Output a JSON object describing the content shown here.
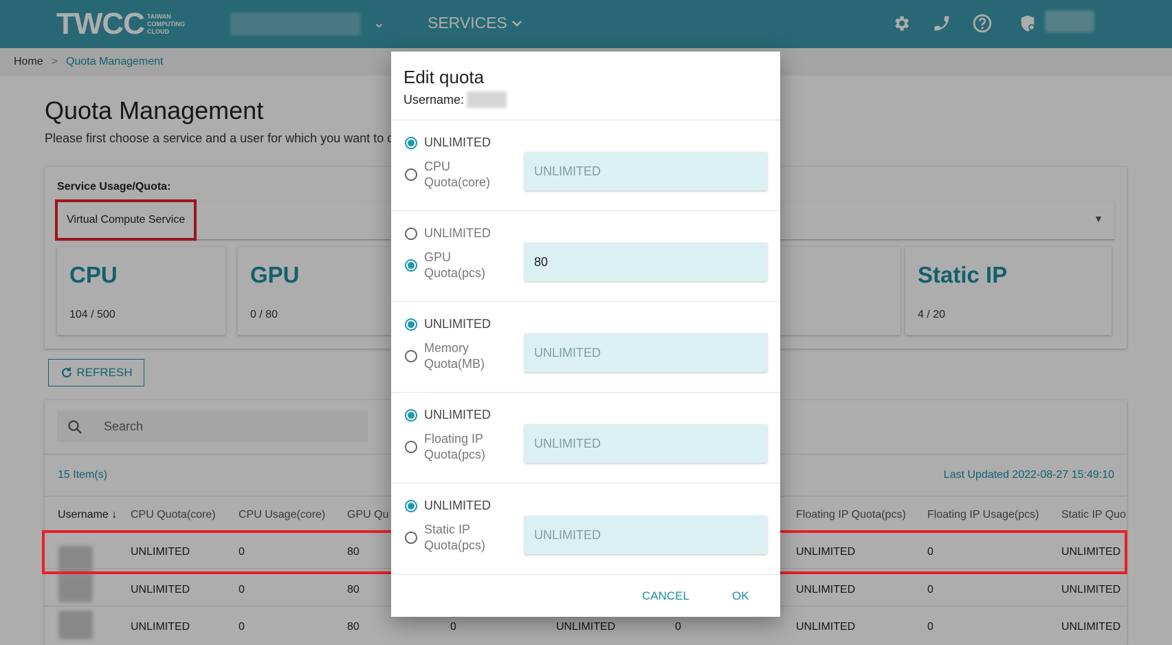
{
  "header": {
    "logo_text": "TWCC",
    "logo_sub": [
      "TAIWAN",
      "COMPUTING",
      "CLOUD"
    ],
    "services_label": "SERVICES",
    "icons": [
      "gear-icon",
      "phone-icon",
      "help-icon",
      "security-icon"
    ]
  },
  "breadcrumb": {
    "home": "Home",
    "separator": ">",
    "current": "Quota Management"
  },
  "page": {
    "title": "Quota Management",
    "description": "Please first choose a service and a user for which you want to c"
  },
  "service": {
    "label": "Service Usage/Quota:",
    "selected": "Virtual Compute Service",
    "cards": [
      {
        "name": "CPU",
        "value": "104 / 500"
      },
      {
        "name": "GPU",
        "value": "0 / 80"
      },
      {
        "name": "Static IP",
        "value": "4 / 20"
      }
    ]
  },
  "refresh_label": "REFRESH",
  "table": {
    "search_placeholder": "Search",
    "item_count": "15 Item(s)",
    "last_updated": "Last Updated 2022-08-27 15:49:10",
    "headers": {
      "username": "Username",
      "cpu_quota": "CPU Quota(core)",
      "cpu_usage": "CPU Usage(core)",
      "gpu_quota": "GPU Qu",
      "fip_quota": "Floating IP Quota(pcs)",
      "fip_usage": "Floating IP Usage(pcs)",
      "sip_quota": "Static IP Quo"
    },
    "rows": [
      {
        "cpu_quota": "UNLIMITED",
        "cpu_usage": "0",
        "gpu_quota": "80",
        "fip_quota": "UNLIMITED",
        "fip_usage": "0",
        "sip_quota": "UNLIMITED"
      },
      {
        "cpu_quota": "UNLIMITED",
        "cpu_usage": "0",
        "gpu_quota": "80",
        "fip_quota": "UNLIMITED",
        "fip_usage": "0",
        "sip_quota": "UNLIMITED"
      },
      {
        "cpu_quota": "UNLIMITED",
        "cpu_usage": "0",
        "gpu_quota": "80",
        "gpu_usage": "0",
        "mem_quota": "UNLIMITED",
        "mem_usage": "0",
        "fip_quota": "UNLIMITED",
        "fip_usage": "0",
        "sip_quota": "UNLIMITED"
      }
    ]
  },
  "dialog": {
    "title": "Edit quota",
    "username_label": "Username:",
    "unlimited_label": "UNLIMITED",
    "sections": [
      {
        "label_line1": "CPU",
        "label_line2": "Quota(core)",
        "unlimited_selected": true,
        "value": "UNLIMITED"
      },
      {
        "label_line1": "GPU",
        "label_line2": "Quota(pcs)",
        "unlimited_selected": false,
        "value": "80"
      },
      {
        "label_line1": "Memory",
        "label_line2": "Quota(MB)",
        "unlimited_selected": true,
        "value": "UNLIMITED"
      },
      {
        "label_line1": "Floating IP",
        "label_line2": "Quota(pcs)",
        "unlimited_selected": true,
        "value": "UNLIMITED"
      },
      {
        "label_line1": "Static IP",
        "label_line2": "Quota(pcs)",
        "unlimited_selected": true,
        "value": "UNLIMITED"
      }
    ],
    "cancel_label": "CANCEL",
    "ok_label": "OK"
  },
  "colors": {
    "header": "#3a9aab",
    "accent": "#1b8fa1",
    "radio": "#1b9bb3",
    "highlight": "#e8202a",
    "field_bg": "#dbf0f3"
  }
}
